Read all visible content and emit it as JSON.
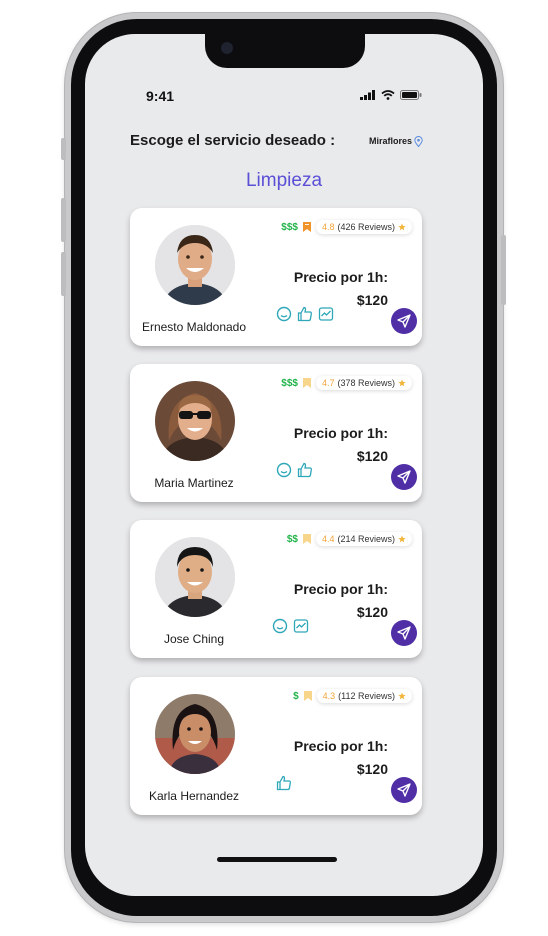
{
  "status_bar": {
    "time": "9:41"
  },
  "header": {
    "title": "Escoge el servicio deseado :",
    "location": "Miraflores"
  },
  "section_title": "Limpieza",
  "cards": [
    {
      "name": "Ernesto Maldonado",
      "price_level": "$$$",
      "rating": "4.8",
      "reviews": "(426 Reviews)",
      "price_label": "Precio por 1h:",
      "price": "$120",
      "bookmark_color": "#f0932b",
      "features": [
        "smile-icon",
        "thumbs-up-icon",
        "chart-icon"
      ]
    },
    {
      "name": "Maria Martinez",
      "price_level": "$$$",
      "rating": "4.7",
      "reviews": "(378 Reviews)",
      "price_label": "Precio por 1h:",
      "price": "$120",
      "bookmark_color": "#f7d58a",
      "features": [
        "smile-icon",
        "thumbs-up-icon"
      ]
    },
    {
      "name": "Jose Ching",
      "price_level": "$$",
      "rating": "4.4",
      "reviews": "(214 Reviews)",
      "price_label": "Precio por 1h:",
      "price": "$120",
      "bookmark_color": "#f7d58a",
      "features": [
        "smile-icon",
        "chart-icon"
      ]
    },
    {
      "name": "Karla Hernandez",
      "price_level": "$",
      "rating": "4.3",
      "reviews": "(112 Reviews)",
      "price_label": "Precio por 1h:",
      "price": "$120",
      "bookmark_color": "#f7d58a",
      "features": [
        "thumbs-up-icon"
      ]
    }
  ],
  "colors": {
    "accent": "#5b4fd6",
    "send_button": "#4f2ea6",
    "price_green": "#22b34a",
    "rating_orange": "#f2a43c",
    "feature_teal": "#2ea7b8"
  }
}
